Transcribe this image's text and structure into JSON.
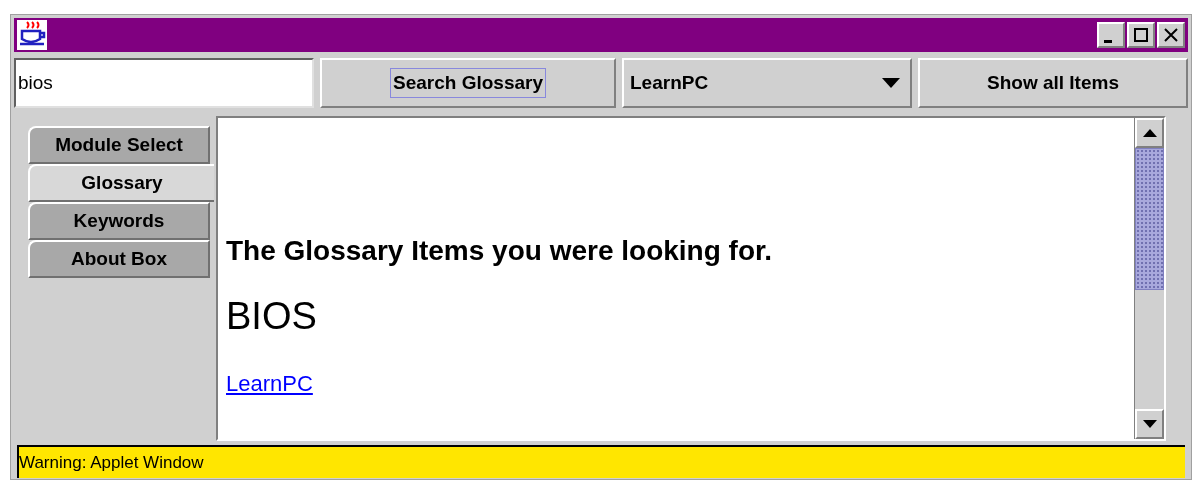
{
  "search": {
    "value": "bios"
  },
  "search_button": {
    "label": "Search Glossary"
  },
  "module_dropdown": {
    "value": "LearnPC"
  },
  "show_all_button": {
    "label": "Show all Items"
  },
  "tabs": [
    {
      "label": "Module Select",
      "selected": false
    },
    {
      "label": "Glossary",
      "selected": true
    },
    {
      "label": "Keywords",
      "selected": false
    },
    {
      "label": "About Box",
      "selected": false
    }
  ],
  "content": {
    "heading": "The Glossary Items you were looking for.",
    "term": "BIOS",
    "link": "LearnPC"
  },
  "status_bar": "Warning: Applet Window"
}
